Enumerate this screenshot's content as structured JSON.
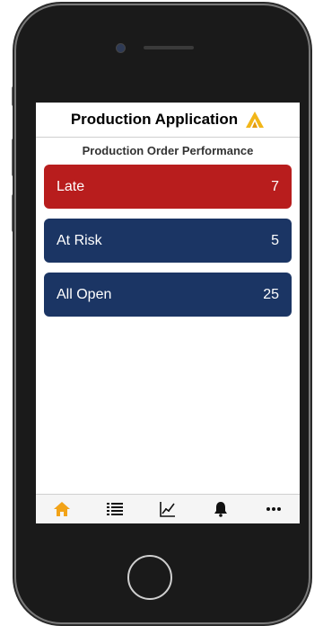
{
  "header": {
    "title": "Production Application",
    "logo_color": "#f2b619"
  },
  "section": {
    "title": "Production Order Performance"
  },
  "cards": [
    {
      "label": "Late",
      "count": "7",
      "color": "#b81d1d"
    },
    {
      "label": "At Risk",
      "count": "5",
      "color": "#1b3564"
    },
    {
      "label": "All Open",
      "count": "25",
      "color": "#1b3564"
    }
  ],
  "tabs": [
    {
      "icon": "home-icon",
      "active": true,
      "active_color": "#f2a318"
    },
    {
      "icon": "list-icon",
      "active": false
    },
    {
      "icon": "chart-icon",
      "active": false
    },
    {
      "icon": "bell-icon",
      "active": false
    },
    {
      "icon": "more-icon",
      "active": false
    }
  ]
}
